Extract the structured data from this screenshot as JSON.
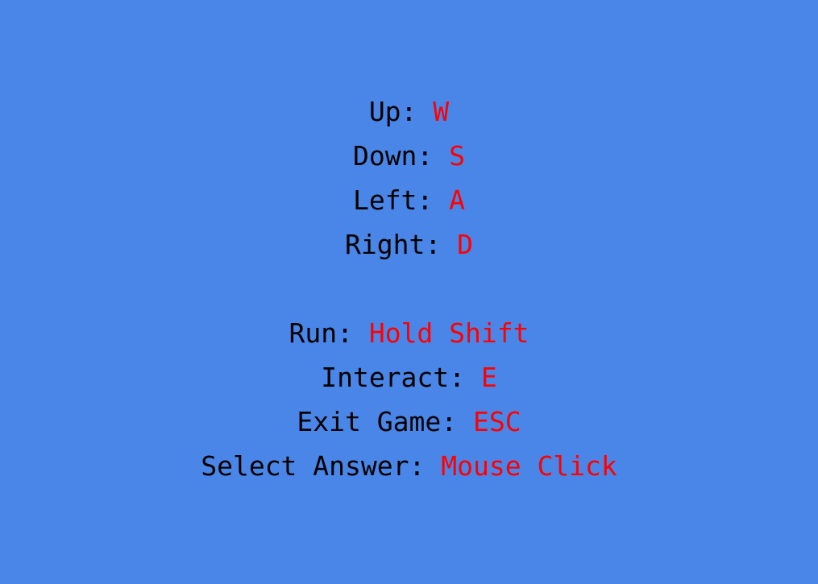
{
  "colors": {
    "background": "#4a86e8",
    "label": "#000000",
    "key": "#ff0000"
  },
  "movement": [
    {
      "label": "Up: ",
      "key": "W"
    },
    {
      "label": "Down: ",
      "key": "S"
    },
    {
      "label": "Left: ",
      "key": "A"
    },
    {
      "label": "Right: ",
      "key": "D"
    }
  ],
  "actions": [
    {
      "label": "Run: ",
      "key": "Hold Shift"
    },
    {
      "label": "Interact: ",
      "key": "E"
    },
    {
      "label": "Exit Game: ",
      "key": "ESC"
    },
    {
      "label": "Select Answer: ",
      "key": "Mouse Click"
    }
  ]
}
